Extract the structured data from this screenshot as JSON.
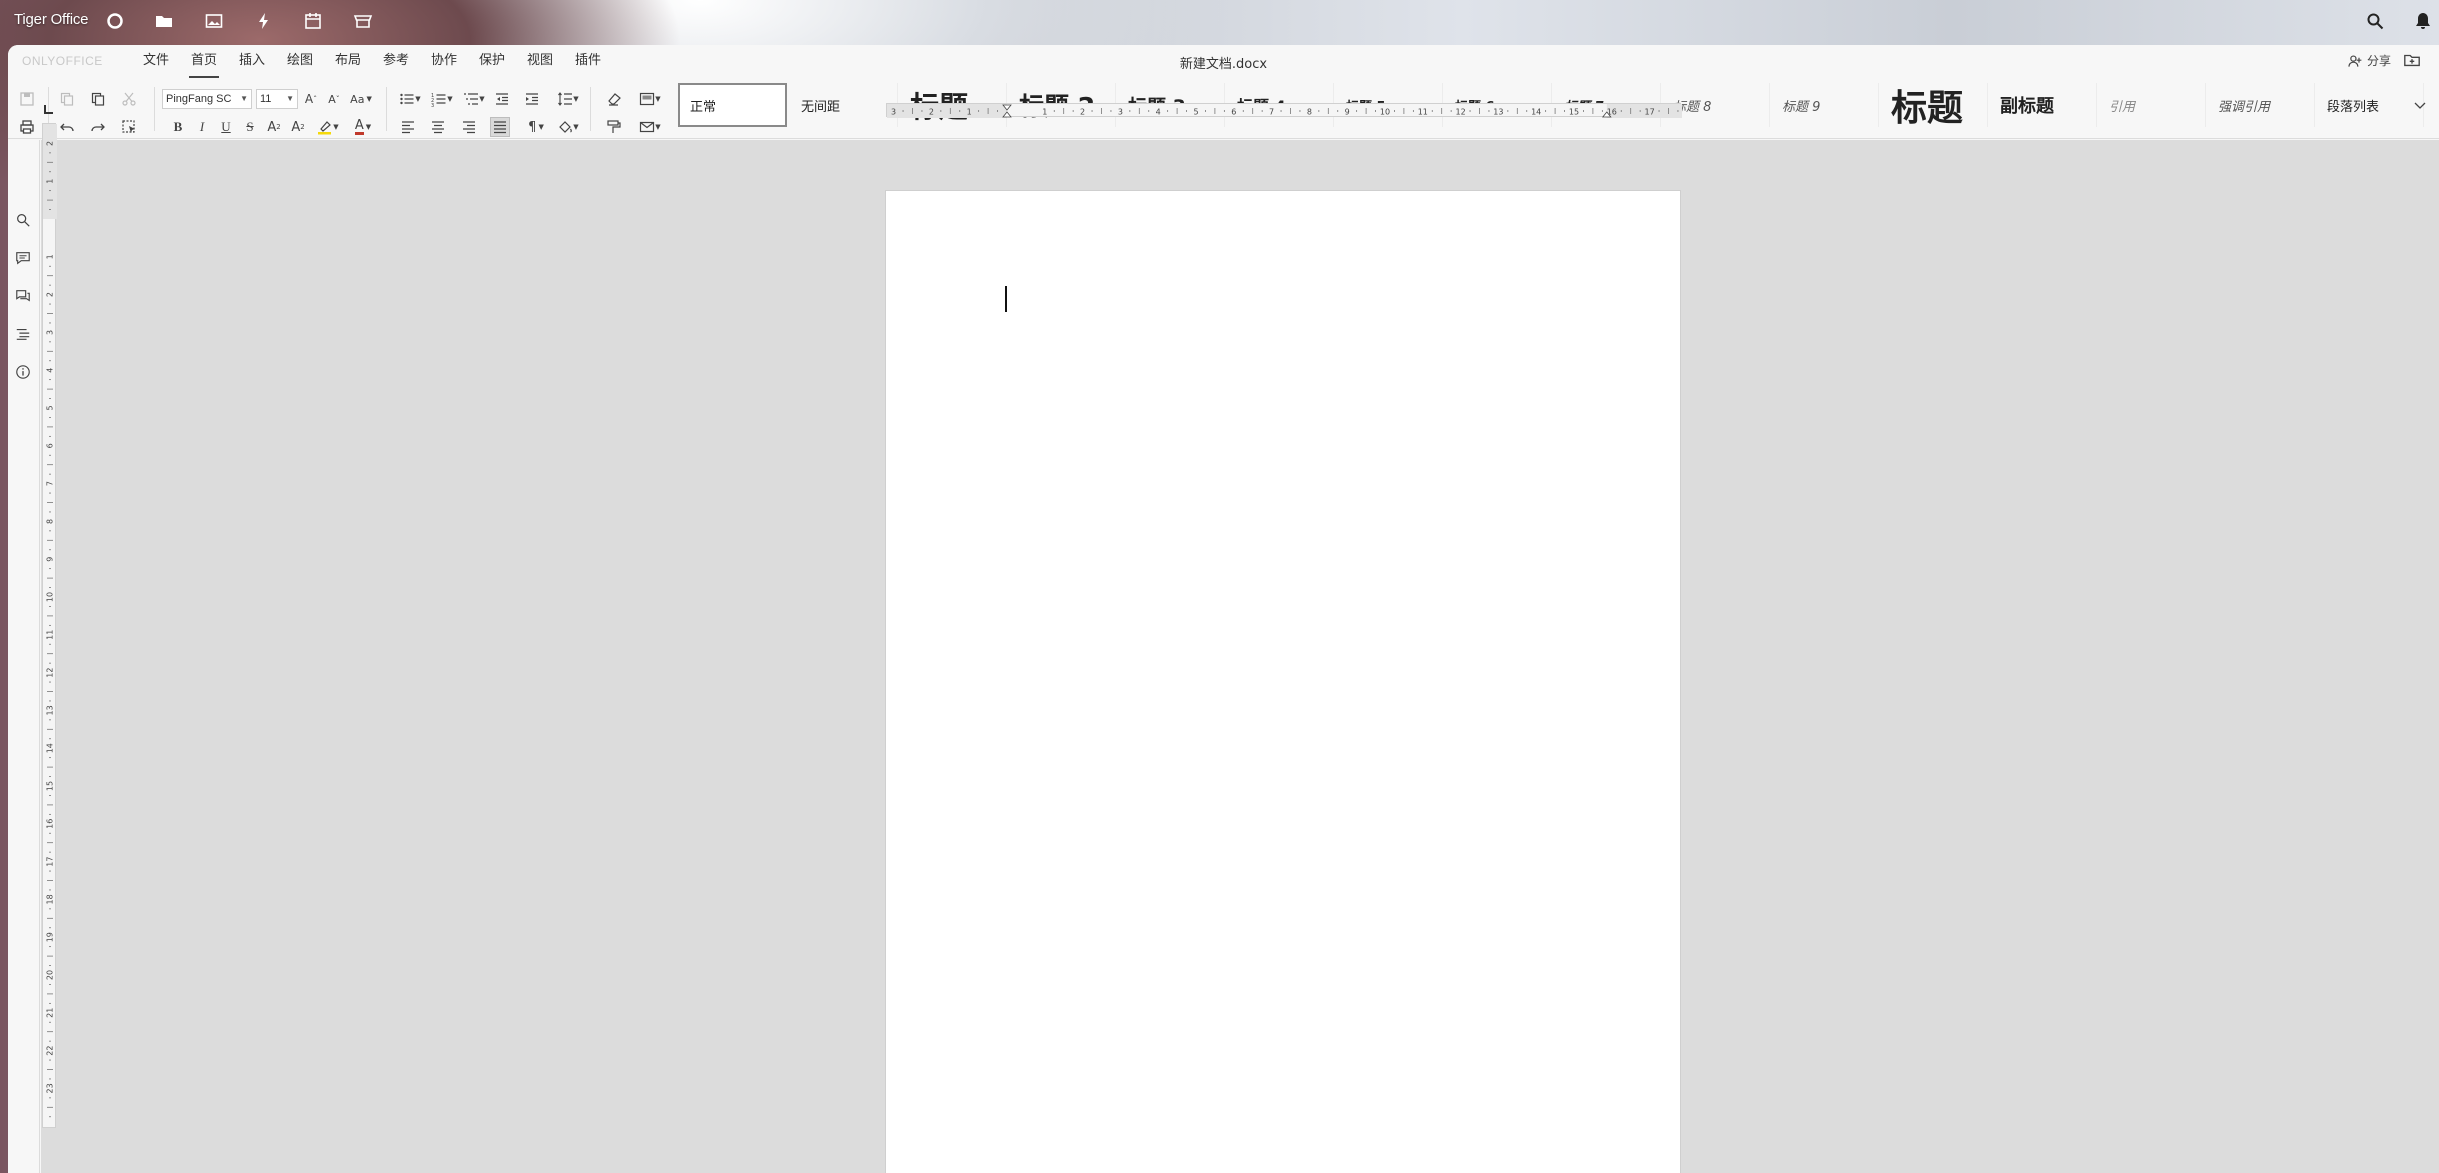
{
  "desktop": {
    "brand": "Tiger Office",
    "dock_icons": [
      "circle-icon",
      "folder-icon",
      "image-icon",
      "lightning-icon",
      "calendar-icon",
      "store-icon"
    ],
    "right_icons": [
      "search-icon",
      "bell-icon"
    ]
  },
  "app": {
    "logo": "ONLYOFFICE",
    "doc_title": "新建文档.docx",
    "share_label": "分享",
    "menu_tabs": [
      "文件",
      "首页",
      "插入",
      "绘图",
      "布局",
      "参考",
      "协作",
      "保护",
      "视图",
      "插件"
    ],
    "active_tab": "首页"
  },
  "toolbar": {
    "font_name": "PingFang SC",
    "font_size": "11",
    "bold": "B",
    "italic": "I",
    "underline": "U",
    "strike": "S",
    "superscript": "A",
    "subscript": "A",
    "font_color": "A",
    "highlight_color": "#f5d90a",
    "text_color": "#c0392b",
    "font_increase": "A",
    "font_decrease": "A",
    "change_case": "Aa"
  },
  "styles": [
    {
      "label": "正常",
      "selected": true
    },
    {
      "label": "无间距"
    },
    {
      "label": "标题"
    },
    {
      "label": "标题 2"
    },
    {
      "label": "标题 3"
    },
    {
      "label": "标题 4"
    },
    {
      "label": "标题 5"
    },
    {
      "label": "标题 6"
    },
    {
      "label": "标题 7"
    },
    {
      "label": "标题 8"
    },
    {
      "label": "标题 9"
    },
    {
      "label": "标题"
    },
    {
      "label": "副标题"
    },
    {
      "label": "引用"
    },
    {
      "label": "强调引用"
    },
    {
      "label": "段落列表"
    }
  ],
  "ruler": {
    "horizontal_labels": [
      "3",
      "2",
      "1",
      "1",
      "2",
      "3",
      "4",
      "5",
      "6",
      "7",
      "8",
      "9",
      "10",
      "11",
      "12",
      "13",
      "14",
      "15",
      "16",
      "17"
    ],
    "vertical_labels": [
      "2",
      "1",
      "1",
      "2",
      "3",
      "4",
      "5",
      "6",
      "7",
      "8",
      "9",
      "10",
      "11",
      "12",
      "13",
      "14",
      "15",
      "16",
      "17",
      "18",
      "19",
      "20",
      "21",
      "22",
      "23"
    ],
    "corner": "L"
  },
  "colors": {
    "accent": "#444444",
    "page": "#ffffff",
    "canvas": "#dcdcdc"
  }
}
